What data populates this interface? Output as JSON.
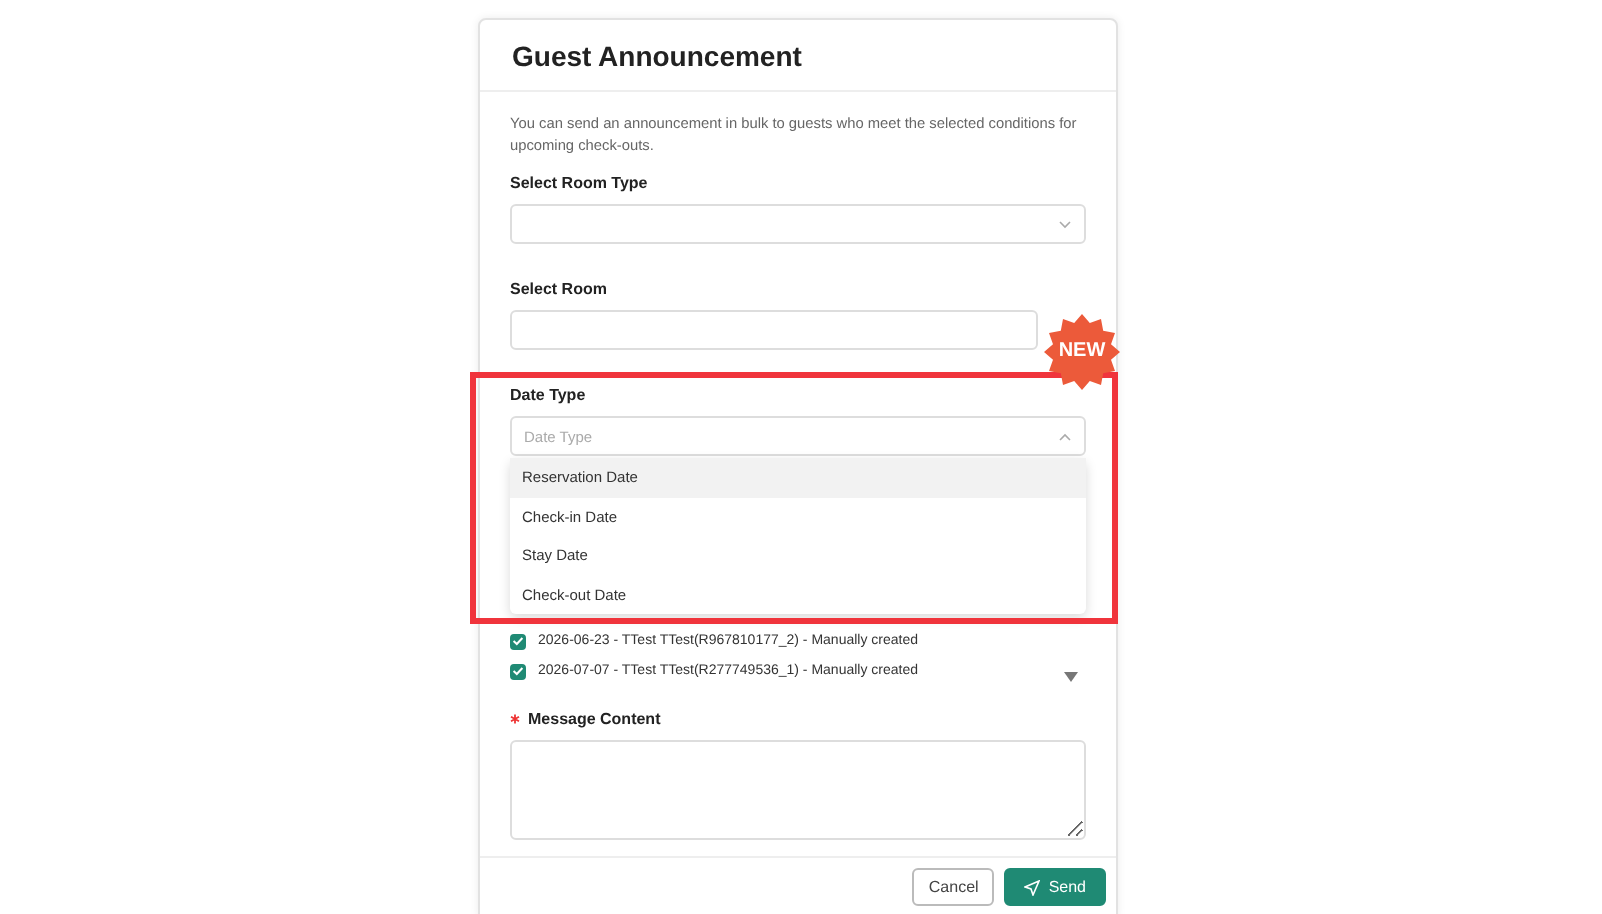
{
  "dialog": {
    "title": "Guest Announcement",
    "description": "You can send an announcement in bulk to guests who meet the selected conditions for upcoming check-outs."
  },
  "room_type": {
    "label": "Select Room Type"
  },
  "room": {
    "label": "Select Room"
  },
  "date_type": {
    "label": "Date Type",
    "placeholder": "Date Type",
    "expanded": true,
    "badge": "NEW",
    "highlighted": true,
    "options": [
      {
        "label": "Reservation Date",
        "selected": true
      },
      {
        "label": "Check-in Date",
        "selected": false
      },
      {
        "label": "Stay Date",
        "selected": false
      },
      {
        "label": "Check-out Date",
        "selected": false
      }
    ]
  },
  "reservations": [
    {
      "label": "2026-06-23 - TTest TTest(R967810177_2) - Manually created",
      "checked": true
    },
    {
      "label": "2026-07-07 - TTest TTest(R277749536_1) - Manually created",
      "checked": true
    }
  ],
  "message": {
    "label": "Message Content",
    "required": true
  },
  "buttons": [
    {
      "label": "Cancel",
      "kind": "secondary"
    },
    {
      "label": "Send",
      "kind": "primary"
    }
  ]
}
